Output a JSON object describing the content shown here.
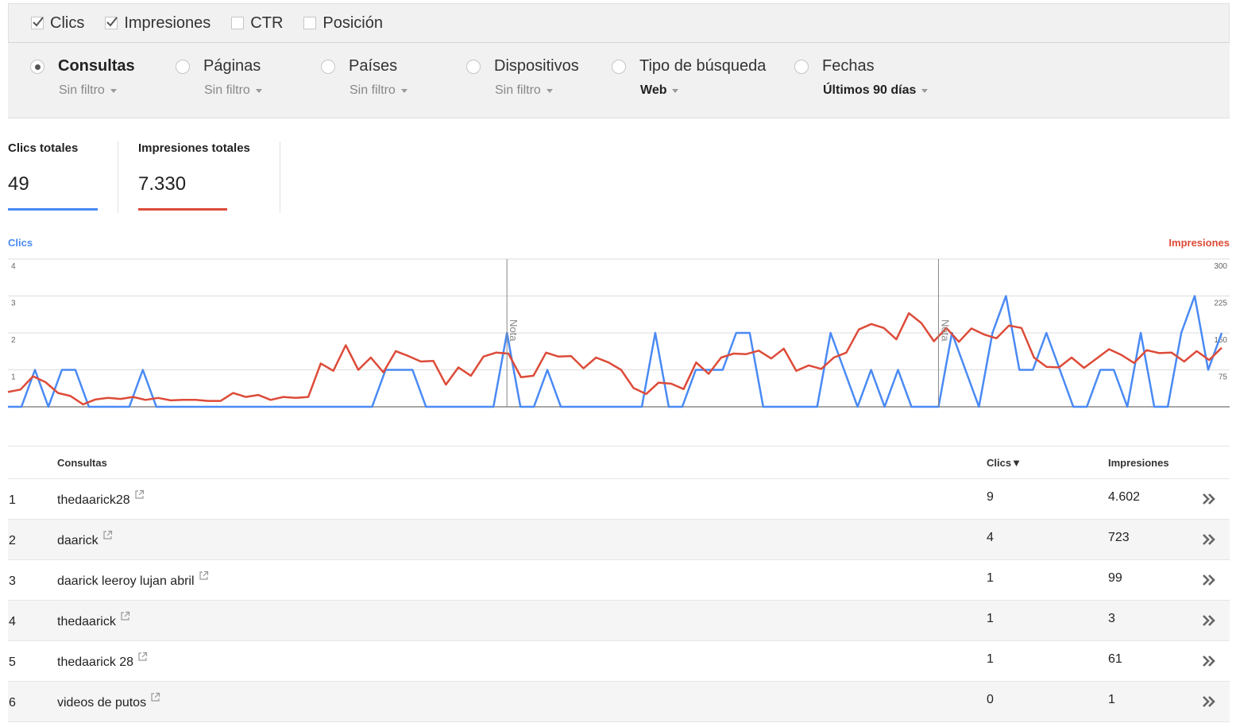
{
  "metrics": [
    {
      "label": "Clics",
      "checked": true
    },
    {
      "label": "Impresiones",
      "checked": true
    },
    {
      "label": "CTR",
      "checked": false
    },
    {
      "label": "Posición",
      "checked": false
    }
  ],
  "dimensions": [
    {
      "label": "Consultas",
      "filter": "Sin filtro",
      "selected": true
    },
    {
      "label": "Páginas",
      "filter": "Sin filtro",
      "selected": false
    },
    {
      "label": "Países",
      "filter": "Sin filtro",
      "selected": false
    },
    {
      "label": "Dispositivos",
      "filter": "Sin filtro",
      "selected": false
    },
    {
      "label": "Tipo de búsqueda",
      "filter": "Web",
      "selected": false
    },
    {
      "label": "Fechas",
      "filter": "Últimos 90 días",
      "selected": false
    }
  ],
  "totals": [
    {
      "label": "Clics totales",
      "value": "49",
      "color": "#4a8af4"
    },
    {
      "label": "Impresiones totales",
      "value": "7.330",
      "color": "#dd4b39"
    }
  ],
  "chart_data": {
    "type": "line",
    "left_axis_title": "Clics",
    "right_axis_title": "Impresiones",
    "left_ticks": [
      "1",
      "2",
      "3",
      "4"
    ],
    "right_ticks": [
      "75",
      "150",
      "225",
      "300"
    ],
    "ylim_left": [
      0,
      4
    ],
    "ylim_right": [
      0,
      300
    ],
    "annotation_label": "Nota",
    "annotations_at_index": [
      37,
      69
    ],
    "series": [
      {
        "name": "Clics",
        "color": "#4a8af4",
        "axis": "left",
        "values": [
          0,
          0,
          1,
          0,
          1,
          1,
          0,
          0,
          0,
          0,
          1,
          0,
          0,
          0,
          0,
          0,
          0,
          0,
          0,
          0,
          0,
          0,
          0,
          0,
          0,
          0,
          0,
          0,
          1,
          1,
          1,
          0,
          0,
          0,
          0,
          0,
          0,
          2,
          0,
          0,
          1,
          0,
          0,
          0,
          0,
          0,
          0,
          0,
          2,
          0,
          0,
          1,
          1,
          1,
          2,
          2,
          0,
          0,
          0,
          0,
          0,
          2,
          1,
          0,
          1,
          0,
          1,
          0,
          0,
          0,
          2,
          1,
          0,
          2,
          3,
          1,
          1,
          2,
          1,
          0,
          0,
          1,
          1,
          0,
          2,
          0,
          0,
          2,
          3,
          1,
          2
        ]
      },
      {
        "name": "Impresiones",
        "color": "#dd4b39",
        "axis": "right",
        "values": [
          30,
          35,
          62,
          50,
          28,
          22,
          5,
          15,
          18,
          16,
          20,
          14,
          18,
          13,
          14,
          14,
          12,
          12,
          28,
          20,
          24,
          14,
          20,
          18,
          20,
          88,
          73,
          125,
          75,
          100,
          70,
          113,
          103,
          92,
          93,
          45,
          80,
          63,
          102,
          110,
          108,
          60,
          63,
          110,
          102,
          103,
          78,
          100,
          90,
          75,
          38,
          26,
          49,
          47,
          36,
          90,
          67,
          100,
          108,
          107,
          114,
          98,
          118,
          73,
          84,
          77,
          100,
          110,
          157,
          168,
          160,
          137,
          190,
          170,
          133,
          160,
          132,
          159,
          147,
          139,
          165,
          160,
          100,
          81,
          80,
          100,
          79,
          98,
          117,
          105,
          89,
          115,
          109,
          110,
          92,
          113,
          95,
          120
        ]
      }
    ]
  },
  "table": {
    "headers": {
      "query": "Consultas",
      "clicks": "Clics▼",
      "impressions": "Impresiones"
    },
    "rows": [
      {
        "rank": "1",
        "query": "thedaarick28",
        "clicks": "9",
        "impressions": "4.602"
      },
      {
        "rank": "2",
        "query": "daarick",
        "clicks": "4",
        "impressions": "723"
      },
      {
        "rank": "3",
        "query": "daarick leeroy lujan abril",
        "clicks": "1",
        "impressions": "99"
      },
      {
        "rank": "4",
        "query": "thedaarick",
        "clicks": "1",
        "impressions": "3"
      },
      {
        "rank": "5",
        "query": "thedaarick 28",
        "clicks": "1",
        "impressions": "61"
      },
      {
        "rank": "6",
        "query": "videos de putos",
        "clicks": "0",
        "impressions": "1"
      }
    ]
  }
}
